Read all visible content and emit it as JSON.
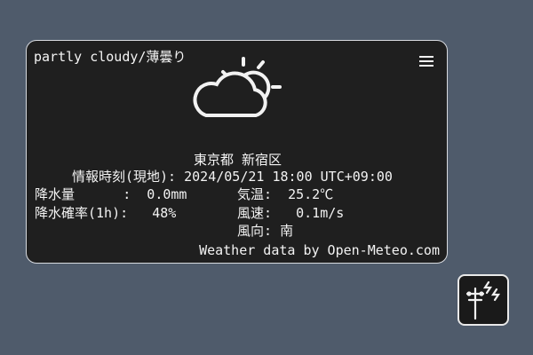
{
  "weather": {
    "condition": "partly cloudy/薄曇り",
    "location": "東京都 新宿区",
    "info_time_label": "情報時刻(現地):",
    "info_time_value": "2024/05/21 18:00 UTC+09:00",
    "rain_label": "降水量",
    "rain_sep": ":",
    "rain_value": "0.0mm",
    "prob_label": "降水確率(1h):",
    "prob_value": "48%",
    "temp_label": "気温:",
    "temp_value": "25.2℃",
    "wind_label": "風速:",
    "wind_value": "0.1m/s",
    "dir_label": "風向:",
    "dir_value": "南",
    "credit": "Weather data by Open-Meteo.com"
  },
  "icons": {
    "menu": "menu-icon",
    "weather": "partly-cloudy-icon",
    "widget": "power-pole-lightning-icon"
  }
}
